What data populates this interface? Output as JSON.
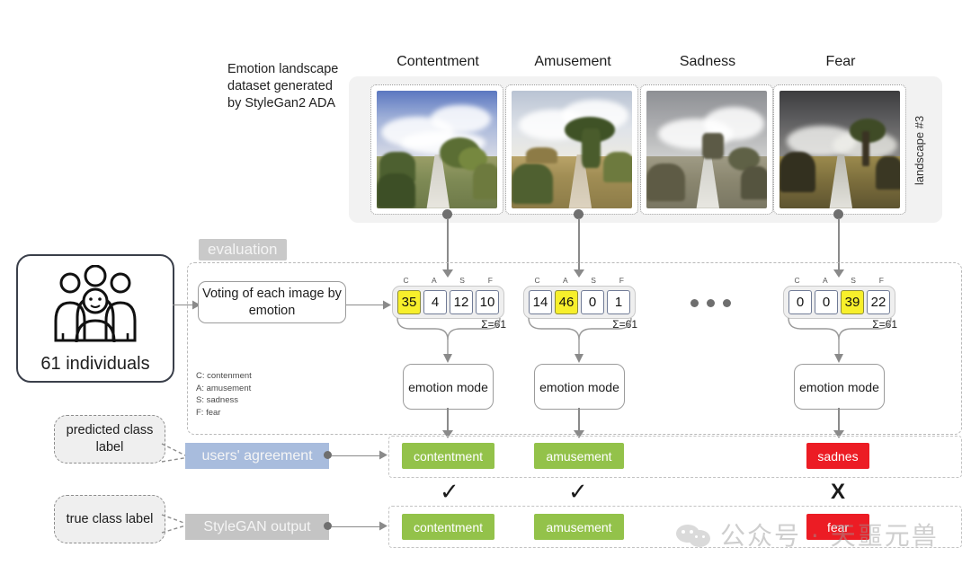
{
  "dataset": {
    "caption": "Emotion landscape dataset generated by StyleGan2 ADA",
    "side_label": "landscape #3",
    "columns": [
      {
        "title": "Contentment",
        "mood": "bright"
      },
      {
        "title": "Amusement",
        "mood": "warm"
      },
      {
        "title": "Sadness",
        "mood": "gray"
      },
      {
        "title": "Fear",
        "mood": "dark"
      }
    ]
  },
  "participants": {
    "count_label": "61 individuals",
    "icon": "people-group-icon"
  },
  "evaluation": {
    "section_label": "evaluation",
    "voting_box_label": "Voting of each image by emotion",
    "legend": [
      "C: contenment",
      "A: amusement",
      "S: sadness",
      "F: fear"
    ],
    "column_letters": [
      "C",
      "A",
      "S",
      "F"
    ],
    "sum_label": "Σ=61",
    "mode_box_label": "emotion mode",
    "ellipsis": "• • •"
  },
  "votes": [
    {
      "values": [
        "35",
        "4",
        "12",
        "10"
      ],
      "highlight": 0,
      "sum": "Σ=61"
    },
    {
      "values": [
        "14",
        "46",
        "0",
        "1"
      ],
      "highlight": 1,
      "sum": "Σ=61"
    },
    {
      "values": [
        "0",
        "0",
        "39",
        "22"
      ],
      "highlight": 2,
      "sum": "Σ=61"
    }
  ],
  "predicted": {
    "callout": "predicted class label",
    "tag": "users' agreement",
    "chips": [
      {
        "label": "contentment",
        "color": "#93c24a"
      },
      {
        "label": "amusement",
        "color": "#93c24a"
      },
      {
        "label": "sadnes",
        "color": "#ec1c24"
      }
    ]
  },
  "truth": {
    "callout": "true class label",
    "tag": "StyleGAN output",
    "chips": [
      {
        "label": "contentment",
        "color": "#93c24a"
      },
      {
        "label": "amusement",
        "color": "#93c24a"
      },
      {
        "label": "fear",
        "color": "#ec1c24"
      }
    ]
  },
  "marks": [
    {
      "glyph": "✓",
      "kind": "check"
    },
    {
      "glyph": "✓",
      "kind": "check"
    },
    {
      "glyph": "X",
      "kind": "cross"
    }
  ],
  "watermark": {
    "text": "公众号 · 天噩元兽",
    "icon": "wechat-icon"
  },
  "colors": {
    "green": "#93c24a",
    "red": "#ec1c24",
    "highlight_yellow": "#f7ef2b",
    "agreement_blue": "#a8bcdd",
    "gray_tag": "#c4c4c4",
    "panel_gray": "#f2f2f2"
  }
}
